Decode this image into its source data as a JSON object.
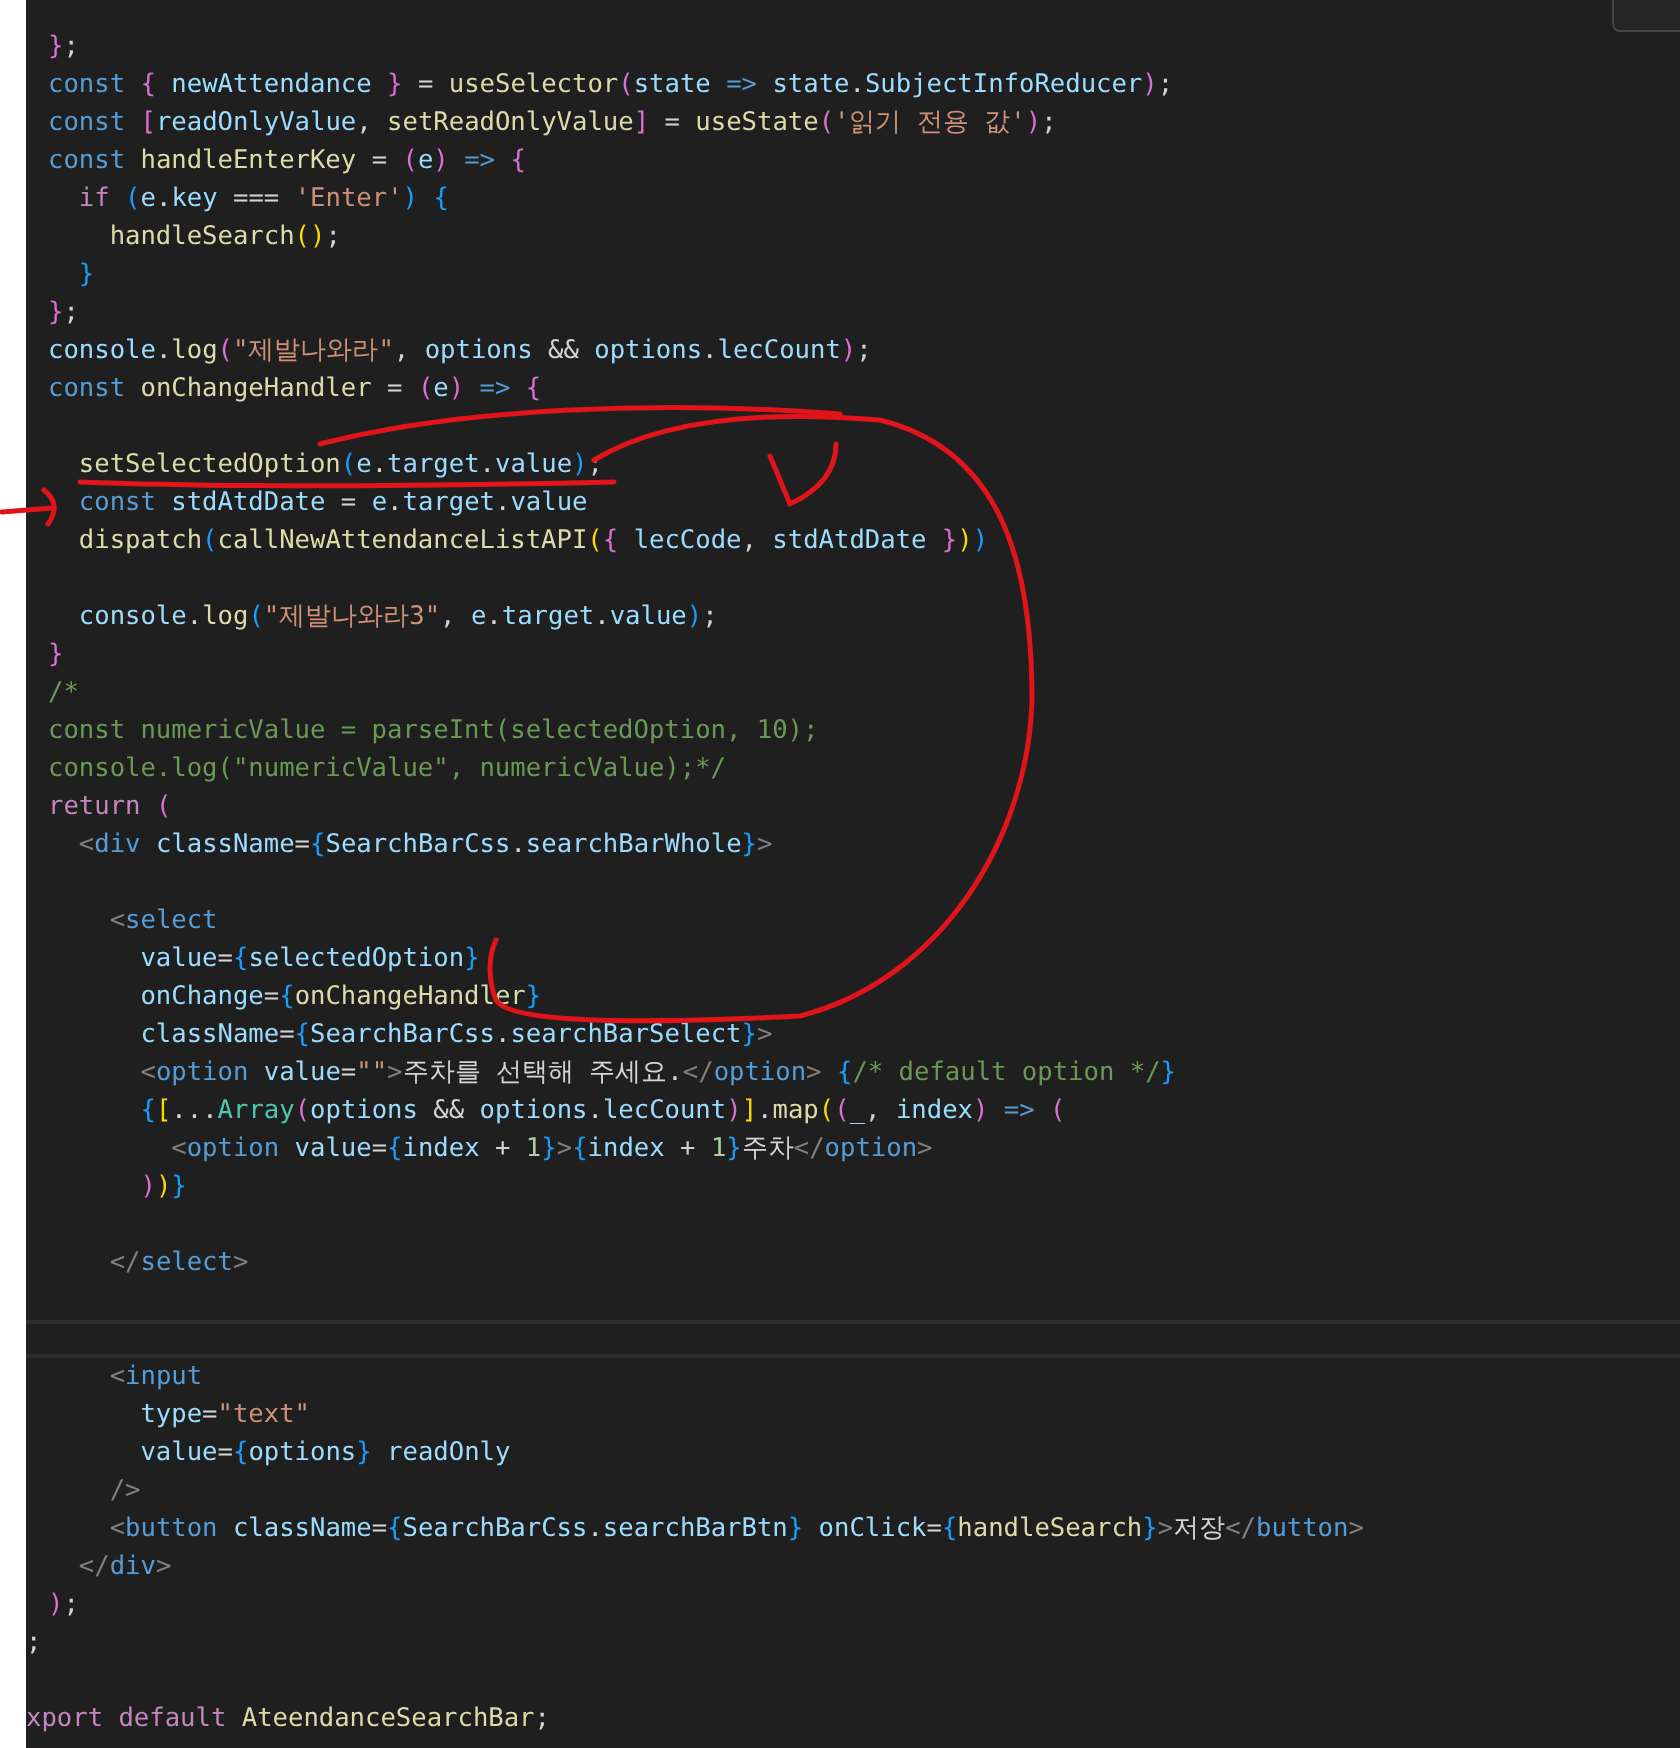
{
  "lines": [
    {
      "kind": "code",
      "tokens": [
        {
          "text": "}",
          "kind": "b2"
        },
        {
          "text": ";",
          "kind": "plain"
        }
      ]
    },
    {
      "kind": "code",
      "tokens": [
        {
          "text": "const ",
          "kind": "keyword"
        },
        {
          "text": "{ ",
          "kind": "b2"
        },
        {
          "text": "newAttendance ",
          "kind": "var"
        },
        {
          "text": "} ",
          "kind": "b2"
        },
        {
          "text": "= ",
          "kind": "plain"
        },
        {
          "text": "useSelector",
          "kind": "func"
        },
        {
          "text": "(",
          "kind": "b2"
        },
        {
          "text": "state ",
          "kind": "var"
        },
        {
          "text": "=> ",
          "kind": "keyword"
        },
        {
          "text": "state",
          "kind": "var"
        },
        {
          "text": ".",
          "kind": "plain"
        },
        {
          "text": "SubjectInfoReducer",
          "kind": "var"
        },
        {
          "text": ")",
          "kind": "b2"
        },
        {
          "text": ";",
          "kind": "plain"
        }
      ]
    },
    {
      "kind": "code",
      "tokens": [
        {
          "text": "const ",
          "kind": "keyword"
        },
        {
          "text": "[",
          "kind": "b2"
        },
        {
          "text": "readOnlyValue",
          "kind": "var"
        },
        {
          "text": ", ",
          "kind": "plain"
        },
        {
          "text": "setReadOnlyValue",
          "kind": "func"
        },
        {
          "text": "] ",
          "kind": "b2"
        },
        {
          "text": "= ",
          "kind": "plain"
        },
        {
          "text": "useState",
          "kind": "func"
        },
        {
          "text": "(",
          "kind": "b2"
        },
        {
          "text": "'읽기 전용 값'",
          "kind": "string"
        },
        {
          "text": ")",
          "kind": "b2"
        },
        {
          "text": ";",
          "kind": "plain"
        }
      ]
    },
    {
      "kind": "code",
      "tokens": [
        {
          "text": "const ",
          "kind": "keyword"
        },
        {
          "text": "handleEnterKey ",
          "kind": "func"
        },
        {
          "text": "= ",
          "kind": "plain"
        },
        {
          "text": "(",
          "kind": "b2"
        },
        {
          "text": "e",
          "kind": "var"
        },
        {
          "text": ") ",
          "kind": "b2"
        },
        {
          "text": "=> ",
          "kind": "keyword"
        },
        {
          "text": "{",
          "kind": "b2"
        }
      ]
    },
    {
      "kind": "code",
      "tokens": [
        {
          "text": "  if ",
          "kind": "control"
        },
        {
          "text": "(",
          "kind": "b3"
        },
        {
          "text": "e",
          "kind": "var"
        },
        {
          "text": ".",
          "kind": "plain"
        },
        {
          "text": "key ",
          "kind": "var"
        },
        {
          "text": "=== ",
          "kind": "plain"
        },
        {
          "text": "'Enter'",
          "kind": "string"
        },
        {
          "text": ") ",
          "kind": "b3"
        },
        {
          "text": "{",
          "kind": "b3"
        }
      ]
    },
    {
      "kind": "code",
      "tokens": [
        {
          "text": "    handleSearch",
          "kind": "func"
        },
        {
          "text": "()",
          "kind": "b1"
        },
        {
          "text": ";",
          "kind": "plain"
        }
      ]
    },
    {
      "kind": "code",
      "tokens": [
        {
          "text": "  }",
          "kind": "b3"
        }
      ]
    },
    {
      "kind": "code",
      "tokens": [
        {
          "text": "}",
          "kind": "b2"
        },
        {
          "text": ";",
          "kind": "plain"
        }
      ]
    },
    {
      "kind": "code",
      "tokens": [
        {
          "text": "console",
          "kind": "var"
        },
        {
          "text": ".",
          "kind": "plain"
        },
        {
          "text": "log",
          "kind": "func"
        },
        {
          "text": "(",
          "kind": "b2"
        },
        {
          "text": "\"제발나와라\"",
          "kind": "string"
        },
        {
          "text": ", ",
          "kind": "plain"
        },
        {
          "text": "options ",
          "kind": "var"
        },
        {
          "text": "&& ",
          "kind": "plain"
        },
        {
          "text": "options",
          "kind": "var"
        },
        {
          "text": ".",
          "kind": "plain"
        },
        {
          "text": "lecCount",
          "kind": "var"
        },
        {
          "text": ")",
          "kind": "b2"
        },
        {
          "text": ";",
          "kind": "plain"
        }
      ]
    },
    {
      "kind": "code",
      "tokens": [
        {
          "text": "const ",
          "kind": "keyword"
        },
        {
          "text": "onChangeHandler ",
          "kind": "func"
        },
        {
          "text": "= ",
          "kind": "plain"
        },
        {
          "text": "(",
          "kind": "b2"
        },
        {
          "text": "e",
          "kind": "var"
        },
        {
          "text": ") ",
          "kind": "b2"
        },
        {
          "text": "=> ",
          "kind": "keyword"
        },
        {
          "text": "{",
          "kind": "b2"
        }
      ]
    },
    {
      "kind": "blank"
    },
    {
      "kind": "code",
      "tokens": [
        {
          "text": "  setSelectedOption",
          "kind": "func"
        },
        {
          "text": "(",
          "kind": "b3"
        },
        {
          "text": "e",
          "kind": "var"
        },
        {
          "text": ".",
          "kind": "plain"
        },
        {
          "text": "target",
          "kind": "var"
        },
        {
          "text": ".",
          "kind": "plain"
        },
        {
          "text": "value",
          "kind": "var"
        },
        {
          "text": ")",
          "kind": "b3"
        },
        {
          "text": ";",
          "kind": "plain"
        }
      ]
    },
    {
      "kind": "code",
      "tokens": [
        {
          "text": "  const ",
          "kind": "keyword"
        },
        {
          "text": "stdAtdDate ",
          "kind": "var"
        },
        {
          "text": "= ",
          "kind": "plain"
        },
        {
          "text": "e",
          "kind": "var"
        },
        {
          "text": ".",
          "kind": "plain"
        },
        {
          "text": "target",
          "kind": "var"
        },
        {
          "text": ".",
          "kind": "plain"
        },
        {
          "text": "value",
          "kind": "var"
        }
      ]
    },
    {
      "kind": "code",
      "tokens": [
        {
          "text": "  dispatch",
          "kind": "func"
        },
        {
          "text": "(",
          "kind": "b3"
        },
        {
          "text": "callNewAttendanceListAPI",
          "kind": "func"
        },
        {
          "text": "(",
          "kind": "b1"
        },
        {
          "text": "{ ",
          "kind": "b2"
        },
        {
          "text": "lecCode",
          "kind": "var"
        },
        {
          "text": ", ",
          "kind": "plain"
        },
        {
          "text": "stdAtdDate ",
          "kind": "var"
        },
        {
          "text": "}",
          "kind": "b2"
        },
        {
          "text": ")",
          "kind": "b1"
        },
        {
          "text": ")",
          "kind": "b3"
        }
      ]
    },
    {
      "kind": "blank"
    },
    {
      "kind": "code",
      "tokens": [
        {
          "text": "  console",
          "kind": "var"
        },
        {
          "text": ".",
          "kind": "plain"
        },
        {
          "text": "log",
          "kind": "func"
        },
        {
          "text": "(",
          "kind": "b3"
        },
        {
          "text": "\"제발나와라3\"",
          "kind": "string"
        },
        {
          "text": ", ",
          "kind": "plain"
        },
        {
          "text": "e",
          "kind": "var"
        },
        {
          "text": ".",
          "kind": "plain"
        },
        {
          "text": "target",
          "kind": "var"
        },
        {
          "text": ".",
          "kind": "plain"
        },
        {
          "text": "value",
          "kind": "var"
        },
        {
          "text": ")",
          "kind": "b3"
        },
        {
          "text": ";",
          "kind": "plain"
        }
      ]
    },
    {
      "kind": "code",
      "tokens": [
        {
          "text": "}",
          "kind": "b2"
        }
      ]
    },
    {
      "kind": "code",
      "tokens": [
        {
          "text": "/*",
          "kind": "comment"
        }
      ]
    },
    {
      "kind": "code",
      "tokens": [
        {
          "text": "const numericValue = parseInt(selectedOption, 10);",
          "kind": "comment"
        }
      ]
    },
    {
      "kind": "code",
      "tokens": [
        {
          "text": "console.log(\"numericValue\", numericValue);*/",
          "kind": "comment"
        }
      ]
    },
    {
      "kind": "code",
      "tokens": [
        {
          "text": "return ",
          "kind": "control"
        },
        {
          "text": "(",
          "kind": "b2"
        }
      ]
    },
    {
      "kind": "code",
      "tokens": [
        {
          "text": "  <",
          "kind": "tagpunct"
        },
        {
          "text": "div ",
          "kind": "tag"
        },
        {
          "text": "className",
          "kind": "var"
        },
        {
          "text": "=",
          "kind": "plain"
        },
        {
          "text": "{",
          "kind": "b3"
        },
        {
          "text": "SearchBarCss",
          "kind": "var"
        },
        {
          "text": ".",
          "kind": "plain"
        },
        {
          "text": "searchBarWhole",
          "kind": "var"
        },
        {
          "text": "}",
          "kind": "b3"
        },
        {
          "text": ">",
          "kind": "tagpunct"
        }
      ]
    },
    {
      "kind": "blank"
    },
    {
      "kind": "code",
      "tokens": [
        {
          "text": "    <",
          "kind": "tagpunct"
        },
        {
          "text": "select",
          "kind": "tag"
        }
      ]
    },
    {
      "kind": "code",
      "tokens": [
        {
          "text": "      value",
          "kind": "var"
        },
        {
          "text": "=",
          "kind": "plain"
        },
        {
          "text": "{",
          "kind": "b3"
        },
        {
          "text": "selectedOption",
          "kind": "var"
        },
        {
          "text": "}",
          "kind": "b3"
        }
      ]
    },
    {
      "kind": "code",
      "tokens": [
        {
          "text": "      onChange",
          "kind": "var"
        },
        {
          "text": "=",
          "kind": "plain"
        },
        {
          "text": "{",
          "kind": "b3"
        },
        {
          "text": "onChangeHandler",
          "kind": "func"
        },
        {
          "text": "}",
          "kind": "b3"
        }
      ]
    },
    {
      "kind": "code",
      "tokens": [
        {
          "text": "      className",
          "kind": "var"
        },
        {
          "text": "=",
          "kind": "plain"
        },
        {
          "text": "{",
          "kind": "b3"
        },
        {
          "text": "SearchBarCss",
          "kind": "var"
        },
        {
          "text": ".",
          "kind": "plain"
        },
        {
          "text": "searchBarSelect",
          "kind": "var"
        },
        {
          "text": "}",
          "kind": "b3"
        },
        {
          "text": ">",
          "kind": "tagpunct"
        }
      ]
    },
    {
      "kind": "code",
      "tokens": [
        {
          "text": "      <",
          "kind": "tagpunct"
        },
        {
          "text": "option ",
          "kind": "tag"
        },
        {
          "text": "value",
          "kind": "var"
        },
        {
          "text": "=",
          "kind": "plain"
        },
        {
          "text": "\"\"",
          "kind": "string"
        },
        {
          "text": ">",
          "kind": "tagpunct"
        },
        {
          "text": "주차를 선택해 주세요.",
          "kind": "plain"
        },
        {
          "text": "</",
          "kind": "tagpunct"
        },
        {
          "text": "option",
          "kind": "tag"
        },
        {
          "text": "> ",
          "kind": "tagpunct"
        },
        {
          "text": "{",
          "kind": "b3"
        },
        {
          "text": "/* default option */",
          "kind": "comment"
        },
        {
          "text": "}",
          "kind": "b3"
        }
      ]
    },
    {
      "kind": "code",
      "tokens": [
        {
          "text": "      {",
          "kind": "b3"
        },
        {
          "text": "[",
          "kind": "b1"
        },
        {
          "text": "...",
          "kind": "plain"
        },
        {
          "text": "Array",
          "kind": "class"
        },
        {
          "text": "(",
          "kind": "b2"
        },
        {
          "text": "options ",
          "kind": "var"
        },
        {
          "text": "&& ",
          "kind": "plain"
        },
        {
          "text": "options",
          "kind": "var"
        },
        {
          "text": ".",
          "kind": "plain"
        },
        {
          "text": "lecCount",
          "kind": "var"
        },
        {
          "text": ")",
          "kind": "b2"
        },
        {
          "text": "]",
          "kind": "b1"
        },
        {
          "text": ".",
          "kind": "plain"
        },
        {
          "text": "map",
          "kind": "func"
        },
        {
          "text": "(",
          "kind": "b1"
        },
        {
          "text": "(",
          "kind": "b2"
        },
        {
          "text": "_",
          "kind": "var"
        },
        {
          "text": ", ",
          "kind": "plain"
        },
        {
          "text": "index",
          "kind": "var"
        },
        {
          "text": ") ",
          "kind": "b2"
        },
        {
          "text": "=> ",
          "kind": "keyword"
        },
        {
          "text": "(",
          "kind": "b2"
        }
      ]
    },
    {
      "kind": "code",
      "tokens": [
        {
          "text": "        <",
          "kind": "tagpunct"
        },
        {
          "text": "option ",
          "kind": "tag"
        },
        {
          "text": "value",
          "kind": "var"
        },
        {
          "text": "=",
          "kind": "plain"
        },
        {
          "text": "{",
          "kind": "b3"
        },
        {
          "text": "index ",
          "kind": "var"
        },
        {
          "text": "+ ",
          "kind": "plain"
        },
        {
          "text": "1",
          "kind": "number"
        },
        {
          "text": "}",
          "kind": "b3"
        },
        {
          "text": ">",
          "kind": "tagpunct"
        },
        {
          "text": "{",
          "kind": "b3"
        },
        {
          "text": "index ",
          "kind": "var"
        },
        {
          "text": "+ ",
          "kind": "plain"
        },
        {
          "text": "1",
          "kind": "number"
        },
        {
          "text": "}",
          "kind": "b3"
        },
        {
          "text": "주차",
          "kind": "plain"
        },
        {
          "text": "</",
          "kind": "tagpunct"
        },
        {
          "text": "option",
          "kind": "tag"
        },
        {
          "text": ">",
          "kind": "tagpunct"
        }
      ]
    },
    {
      "kind": "code",
      "tokens": [
        {
          "text": "      )",
          "kind": "b2"
        },
        {
          "text": ")",
          "kind": "b1"
        },
        {
          "text": "}",
          "kind": "b3"
        }
      ]
    },
    {
      "kind": "blank"
    },
    {
      "kind": "code",
      "tokens": [
        {
          "text": "    </",
          "kind": "tagpunct"
        },
        {
          "text": "select",
          "kind": "tag"
        },
        {
          "text": ">",
          "kind": "tagpunct"
        }
      ]
    },
    {
      "kind": "blank"
    },
    {
      "kind": "current"
    },
    {
      "kind": "code",
      "tokens": [
        {
          "text": "    <",
          "kind": "tagpunct"
        },
        {
          "text": "input",
          "kind": "tag"
        }
      ]
    },
    {
      "kind": "code",
      "tokens": [
        {
          "text": "      type",
          "kind": "var"
        },
        {
          "text": "=",
          "kind": "plain"
        },
        {
          "text": "\"text\"",
          "kind": "string"
        }
      ]
    },
    {
      "kind": "code",
      "tokens": [
        {
          "text": "      value",
          "kind": "var"
        },
        {
          "text": "=",
          "kind": "plain"
        },
        {
          "text": "{",
          "kind": "b3"
        },
        {
          "text": "options",
          "kind": "var"
        },
        {
          "text": "} ",
          "kind": "b3"
        },
        {
          "text": "readOnly",
          "kind": "var"
        }
      ]
    },
    {
      "kind": "code",
      "tokens": [
        {
          "text": "    />",
          "kind": "tagpunct"
        }
      ]
    },
    {
      "kind": "code",
      "tokens": [
        {
          "text": "    <",
          "kind": "tagpunct"
        },
        {
          "text": "button ",
          "kind": "tag"
        },
        {
          "text": "className",
          "kind": "var"
        },
        {
          "text": "=",
          "kind": "plain"
        },
        {
          "text": "{",
          "kind": "b3"
        },
        {
          "text": "SearchBarCss",
          "kind": "var"
        },
        {
          "text": ".",
          "kind": "plain"
        },
        {
          "text": "searchBarBtn",
          "kind": "var"
        },
        {
          "text": "} ",
          "kind": "b3"
        },
        {
          "text": "onClick",
          "kind": "var"
        },
        {
          "text": "=",
          "kind": "plain"
        },
        {
          "text": "{",
          "kind": "b3"
        },
        {
          "text": "handleSearch",
          "kind": "func"
        },
        {
          "text": "}",
          "kind": "b3"
        },
        {
          "text": ">",
          "kind": "tagpunct"
        },
        {
          "text": "저장",
          "kind": "plain"
        },
        {
          "text": "</",
          "kind": "tagpunct"
        },
        {
          "text": "button",
          "kind": "tag"
        },
        {
          "text": ">",
          "kind": "tagpunct"
        }
      ]
    },
    {
      "kind": "code",
      "tokens": [
        {
          "text": "  </",
          "kind": "tagpunct"
        },
        {
          "text": "div",
          "kind": "tag"
        },
        {
          "text": ">",
          "kind": "tagpunct"
        }
      ]
    },
    {
      "kind": "code",
      "tokens": [
        {
          "text": ")",
          "kind": "b2"
        },
        {
          "text": ";",
          "kind": "plain"
        }
      ]
    },
    {
      "kind": "clipped",
      "tokens": [
        {
          "text": ";",
          "kind": "plain"
        }
      ]
    },
    {
      "kind": "blank"
    },
    {
      "kind": "clipped",
      "tokens": [
        {
          "text": "xport default ",
          "kind": "control"
        },
        {
          "text": "AteendanceSearchBar",
          "kind": "func"
        },
        {
          "text": ";",
          "kind": "plain"
        }
      ]
    }
  ]
}
